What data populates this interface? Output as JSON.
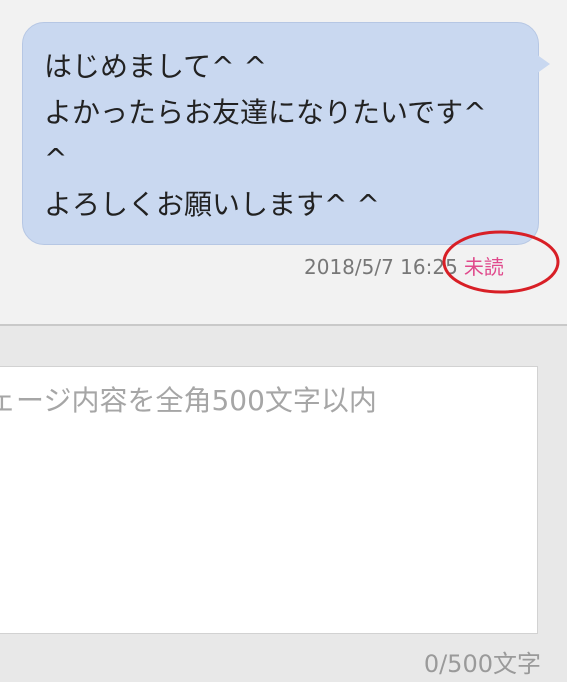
{
  "message": {
    "lines": [
      "はじめまして^ ^",
      "よかったらお友達になりたいです^",
      "^",
      "よろしくお願いします^ ^"
    ],
    "timestamp": "2018/5/7 16:25",
    "status": "未読"
  },
  "composer": {
    "placeholder": "ェージ内容を全角500文字以内",
    "counter": "0/500文字"
  },
  "colors": {
    "bubble": "#c9d8f0",
    "unread": "#e04a8c",
    "annotation": "#d81f26"
  }
}
